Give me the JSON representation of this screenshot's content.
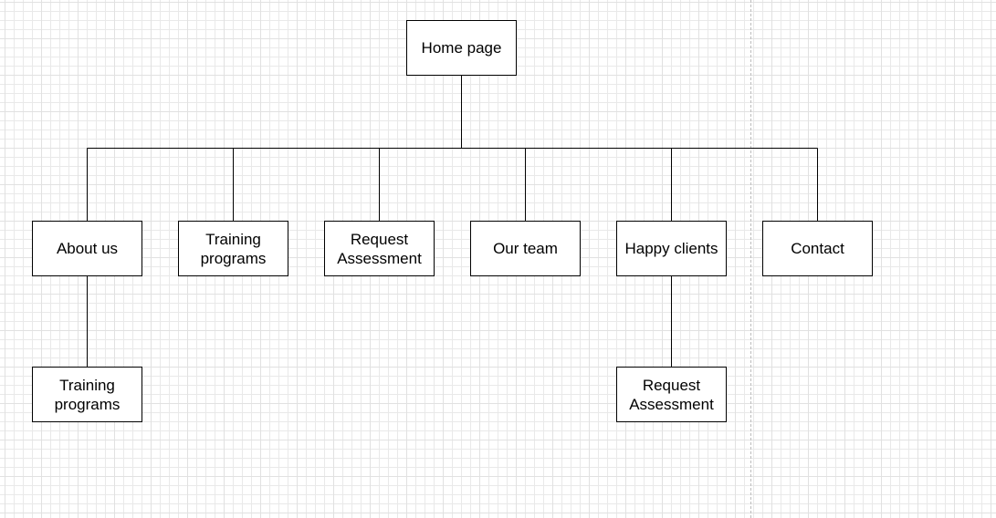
{
  "diagram": {
    "nodes": {
      "home": {
        "label": "Home page"
      },
      "about": {
        "label": "About us"
      },
      "training": {
        "label": "Training\nprograms"
      },
      "request": {
        "label": "Request\nAssessment"
      },
      "team": {
        "label": "Our team"
      },
      "clients": {
        "label": "Happy clients"
      },
      "contact": {
        "label": "Contact"
      },
      "about_training": {
        "label": "Training\nprograms"
      },
      "clients_request": {
        "label": "Request\nAssessment"
      }
    },
    "edges": [
      {
        "from": "Home page",
        "to": "About us"
      },
      {
        "from": "Home page",
        "to": "Training programs"
      },
      {
        "from": "Home page",
        "to": "Request Assessment"
      },
      {
        "from": "Home page",
        "to": "Our team"
      },
      {
        "from": "Home page",
        "to": "Happy clients"
      },
      {
        "from": "Home page",
        "to": "Contact"
      },
      {
        "from": "About us",
        "to": "Training programs"
      },
      {
        "from": "Happy clients",
        "to": "Request Assessment"
      }
    ]
  }
}
